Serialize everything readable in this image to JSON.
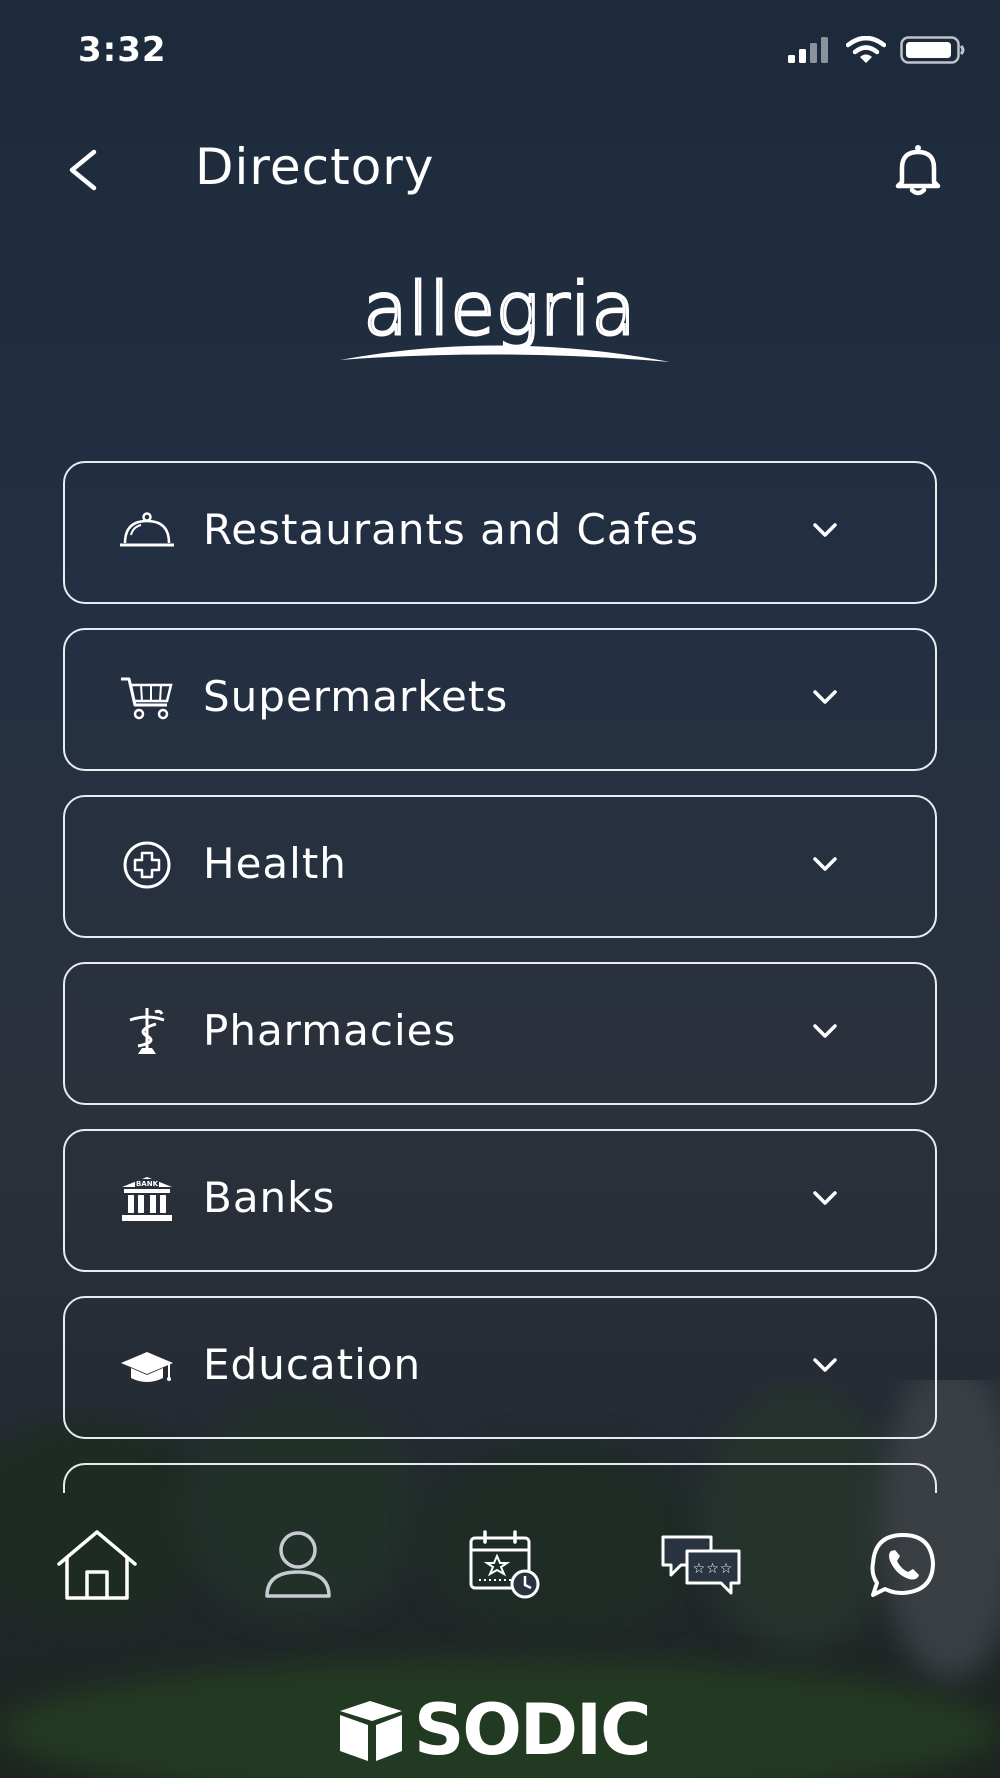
{
  "status": {
    "time": "3:32"
  },
  "header": {
    "title": "Directory"
  },
  "logo": {
    "text": "allegria"
  },
  "directory": {
    "items": [
      {
        "label": "Restaurants and Cafes",
        "icon": "cloche-icon"
      },
      {
        "label": "Supermarkets",
        "icon": "shopping-cart-icon"
      },
      {
        "label": "Health",
        "icon": "medical-cross-icon"
      },
      {
        "label": "Pharmacies",
        "icon": "caduceus-icon"
      },
      {
        "label": "Banks",
        "icon": "bank-icon"
      },
      {
        "label": "Education",
        "icon": "graduation-cap-icon"
      }
    ]
  },
  "tabbar": {
    "tabs": [
      {
        "name": "home",
        "icon": "home-icon"
      },
      {
        "name": "profile",
        "icon": "user-icon"
      },
      {
        "name": "events",
        "icon": "calendar-star-icon"
      },
      {
        "name": "reviews",
        "icon": "chat-bubbles-icon"
      },
      {
        "name": "whatsapp",
        "icon": "whatsapp-icon"
      }
    ]
  },
  "brand": {
    "text": "SODIC"
  },
  "colors": {
    "border": "#e8ecf0",
    "text": "#ffffff",
    "background": "#233043"
  }
}
